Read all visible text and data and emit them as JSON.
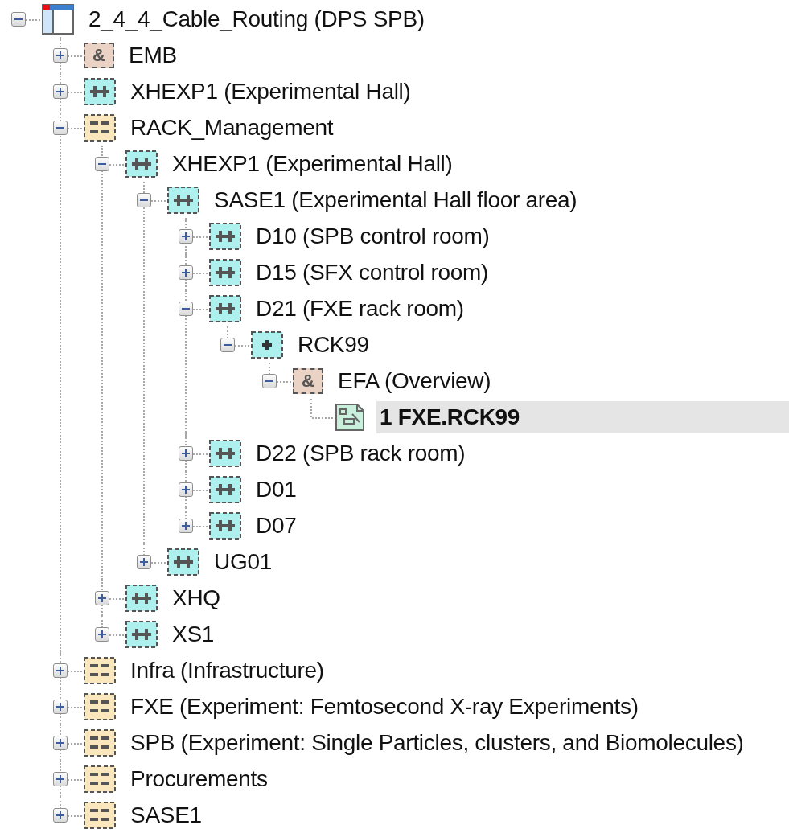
{
  "tree": [
    {
      "label": "2_4_4_Cable_Routing (DPS SPB)",
      "kind": "root",
      "expanded": true,
      "selected": false,
      "children": [
        {
          "label": "EMB",
          "kind": "amp",
          "badge": "&",
          "expanded": false,
          "selected": false
        },
        {
          "label": "XHEXP1 (Experimental Hall)",
          "kind": "hall",
          "expanded": false,
          "selected": false
        },
        {
          "label": "RACK_Management",
          "kind": "group",
          "expanded": true,
          "selected": false,
          "children": [
            {
              "label": "XHEXP1 (Experimental Hall)",
              "kind": "hall",
              "expanded": true,
              "selected": false,
              "children": [
                {
                  "label": "SASE1 (Experimental Hall floor area)",
                  "kind": "hall",
                  "expanded": true,
                  "selected": false,
                  "children": [
                    {
                      "label": "D10 (SPB control room)",
                      "kind": "hall",
                      "expanded": false,
                      "selected": false
                    },
                    {
                      "label": "D15 (SFX control room)",
                      "kind": "hall",
                      "expanded": false,
                      "selected": false
                    },
                    {
                      "label": "D21 (FXE rack room)",
                      "kind": "hall",
                      "expanded": true,
                      "selected": false,
                      "children": [
                        {
                          "label": "RCK99",
                          "kind": "rack",
                          "expanded": true,
                          "selected": false,
                          "children": [
                            {
                              "label": "EFA (Overview)",
                              "kind": "amp",
                              "badge": "&",
                              "expanded": true,
                              "selected": false,
                              "children": [
                                {
                                  "label": "1 FXE.RCK99",
                                  "kind": "drawing",
                                  "selected": true
                                }
                              ]
                            }
                          ]
                        }
                      ]
                    },
                    {
                      "label": "D22 (SPB rack room)",
                      "kind": "hall",
                      "expanded": false,
                      "selected": false
                    },
                    {
                      "label": "D01",
                      "kind": "hall",
                      "expanded": false,
                      "selected": false
                    },
                    {
                      "label": "D07",
                      "kind": "hall",
                      "expanded": false,
                      "selected": false
                    }
                  ]
                },
                {
                  "label": "UG01",
                  "kind": "hall",
                  "expanded": false,
                  "selected": false
                }
              ]
            },
            {
              "label": "XHQ",
              "kind": "hall",
              "expanded": false,
              "selected": false
            },
            {
              "label": "XS1",
              "kind": "hall",
              "expanded": false,
              "selected": false
            }
          ]
        },
        {
          "label": "Infra (Infrastructure)",
          "kind": "group",
          "expanded": false,
          "selected": false
        },
        {
          "label": "FXE (Experiment: Femtosecond X-ray Experiments)",
          "kind": "group",
          "expanded": false,
          "selected": false
        },
        {
          "label": "SPB (Experiment: Single Particles, clusters, and Biomolecules)",
          "kind": "group",
          "expanded": false,
          "selected": false
        },
        {
          "label": "Procurements",
          "kind": "group",
          "expanded": false,
          "selected": false
        },
        {
          "label": "SASE1",
          "kind": "group",
          "expanded": false,
          "selected": false
        }
      ]
    }
  ]
}
